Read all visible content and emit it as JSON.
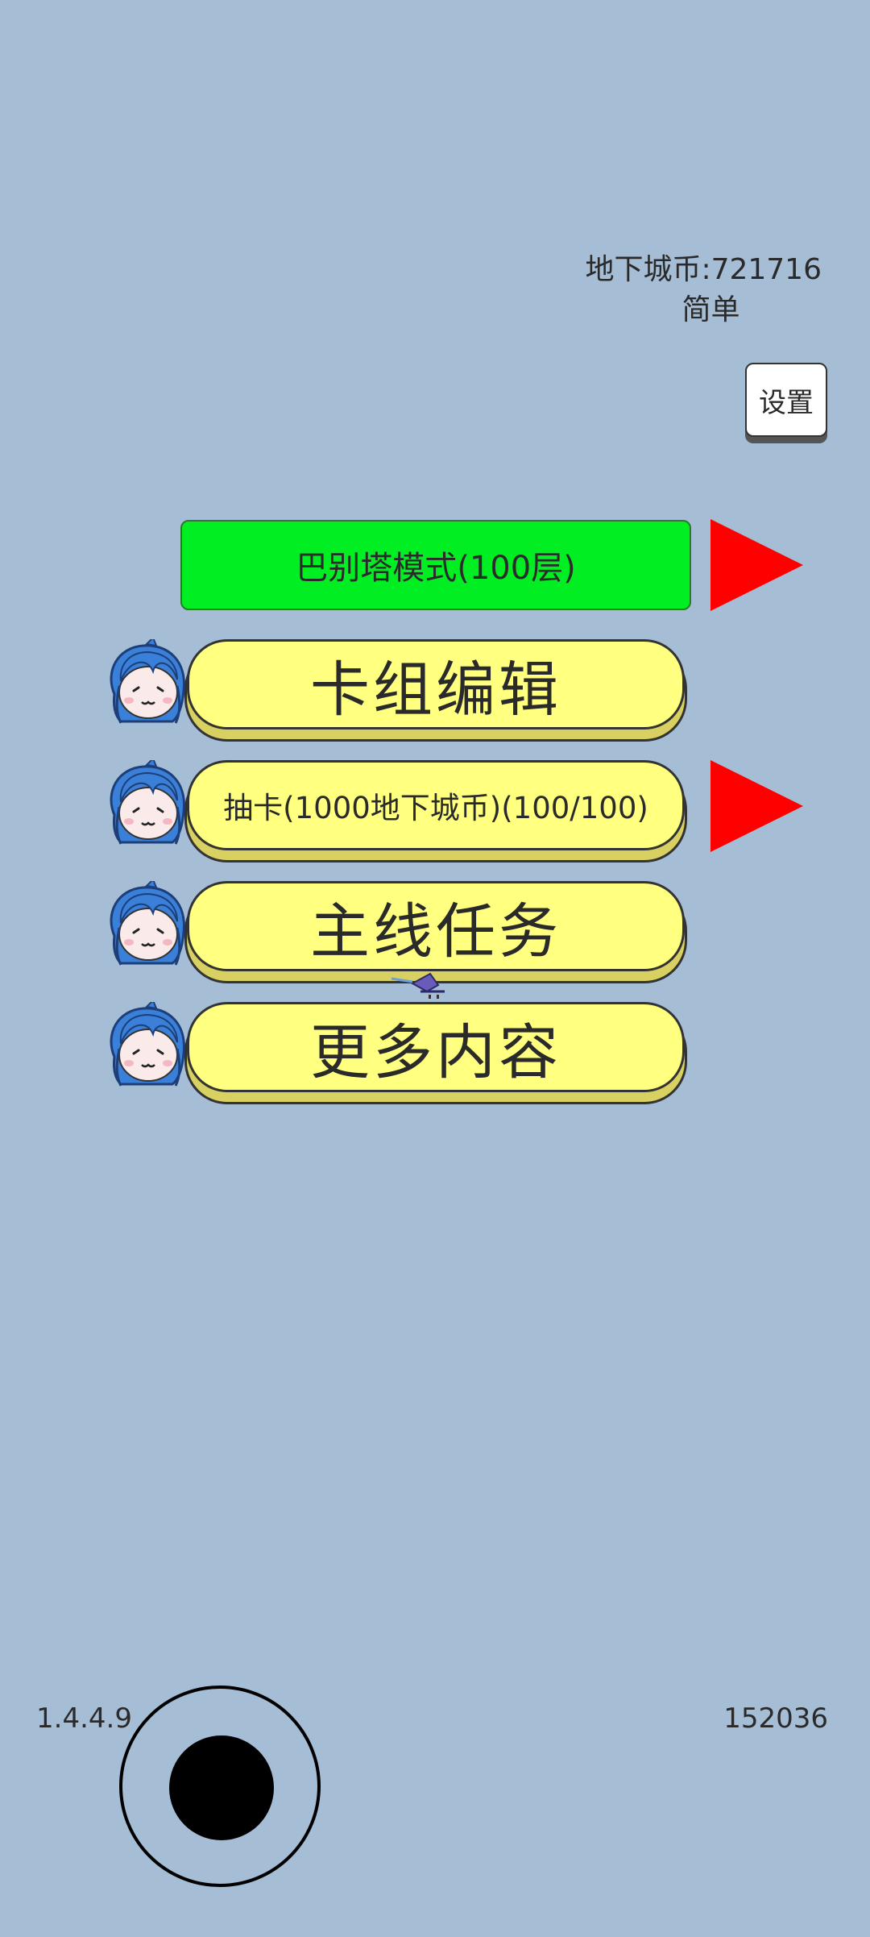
{
  "hud": {
    "currency_text": "地下城币:721716",
    "difficulty": "简单",
    "settings_label": "设置",
    "version": "1.4.4.9",
    "score": "152036"
  },
  "menu": {
    "babel_mode_label": "巴别塔模式(100层)",
    "deck_edit_label": "卡组编辑",
    "gacha_label": "抽卡(1000地下城币)(100/100)",
    "main_quest_label": "主线任务",
    "more_content_label": "更多内容"
  },
  "icons": {
    "avatar": "blue-haired-girl-face-icon",
    "arrow": "red-play-arrow-icon",
    "joystick": "virtual-joystick"
  },
  "colors": {
    "background": "#a6bdd6",
    "babel_button": "#00ee22",
    "menu_button": "#ffff80",
    "arrow": "#ff0000"
  }
}
